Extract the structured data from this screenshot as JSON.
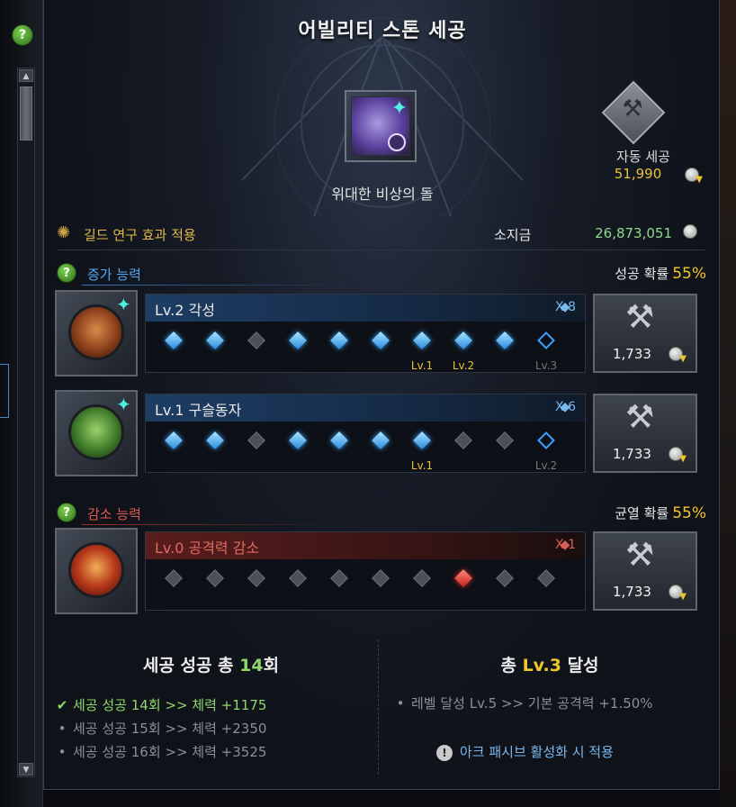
{
  "title": "어빌리티 스톤 세공",
  "help_glyph": "?",
  "stone": {
    "name": "위대한 비상의 돌"
  },
  "auto": {
    "label": "자동 세공",
    "cost": "51,990"
  },
  "guild": {
    "text": "길드 연구 효과 적용"
  },
  "money": {
    "label": "소지금",
    "value": "26,873,051"
  },
  "increase": {
    "title": "증가 능력",
    "rate_label": "성공 확률",
    "rate": "55%"
  },
  "decrease": {
    "title": "감소 능력",
    "rate_label": "균열 확률",
    "rate": "55%"
  },
  "abilities": [
    {
      "name": "Lv.2 각성",
      "mult": "X 8",
      "cost": "1,733",
      "gems": [
        "success",
        "success",
        "fail",
        "success",
        "success",
        "success",
        "success",
        "success",
        "success",
        "empty"
      ],
      "labels": [
        {
          "idx": 6,
          "text": "Lv.1",
          "dim": false
        },
        {
          "idx": 7,
          "text": "Lv.2",
          "dim": false
        },
        {
          "idx": 9,
          "text": "Lv.3",
          "dim": true
        }
      ]
    },
    {
      "name": "Lv.1 구슬동자",
      "mult": "X 6",
      "cost": "1,733",
      "gems": [
        "success",
        "success",
        "fail",
        "success",
        "success",
        "success",
        "success",
        "fail",
        "fail",
        "empty"
      ],
      "labels": [
        {
          "idx": 6,
          "text": "Lv.1",
          "dim": false
        },
        {
          "idx": 9,
          "text": "Lv.2",
          "dim": true
        }
      ]
    },
    {
      "name": "Lv.0 공격력 감소",
      "mult": "X 1",
      "cost": "1,733",
      "gems": [
        "fail",
        "fail",
        "fail",
        "fail",
        "fail",
        "fail",
        "fail",
        "red",
        "fail",
        "fail"
      ],
      "labels": []
    }
  ],
  "summary": {
    "left_prefix": "세공 성공 총 ",
    "left_count": "14",
    "left_suffix": "회",
    "right_prefix": "총 ",
    "right_level": "Lv.3",
    "right_suffix": " 달성",
    "success_items": [
      {
        "text": "세공 성공 14회 >> 체력 +1175",
        "done": true
      },
      {
        "text": "세공 성공 15회 >> 체력 +2350",
        "done": false
      },
      {
        "text": "세공 성공 16회 >> 체력 +3525",
        "done": false
      }
    ],
    "level_item": "레벨 달성 Lv.5 >> 기본 공격력 +1.50%",
    "notice": "아크 패시브 활성화 시 적용"
  },
  "colors": {
    "accent_blue": "#57a7ee",
    "accent_red": "#e05a4f",
    "gold": "#f2c72e",
    "green": "#8fd86a"
  }
}
